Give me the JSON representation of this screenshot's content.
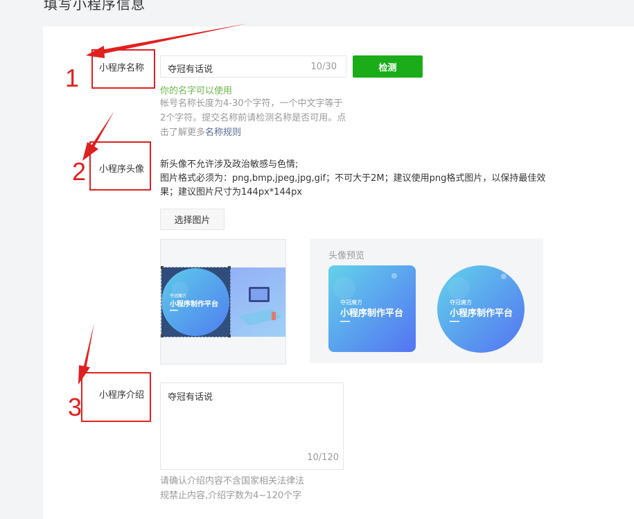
{
  "page": {
    "heading": "填写小程序信息"
  },
  "name_section": {
    "label": "小程序名称",
    "input_value": "夺冠有话说",
    "input_count": "10/30",
    "check_button": "检测",
    "success_text": "你的名字可以使用",
    "hint_line1": "帐号名称长度为4-30个字符，一个中文字等于",
    "hint_line2": "2个字符。提交名称前请检测名称是否可用。点",
    "hint_line3_prefix": "击了解更多",
    "hint_link": "名称规则"
  },
  "avatar_section": {
    "label": "小程序头像",
    "desc_line1": "新头像不允许涉及政治敏感与色情;",
    "desc_line2": "图片格式必须为：png,bmp,jpeg,jpg,gif；不可大于2M；建议使用png格式图片，以保持最佳效",
    "desc_line3": "果；建议图片尺寸为144px*144px",
    "select_button": "选择图片",
    "preview_title": "头像预览",
    "brand_small": "夺冠魔方",
    "brand_big": "小程序制作平台"
  },
  "intro_section": {
    "label": "小程序介绍",
    "textarea_value": "夺冠有话说",
    "textarea_count": "10/120",
    "hint_line1": "请确认介绍内容不含国家相关法律法",
    "hint_line2": "规禁止内容,介绍字数为4~120个字"
  },
  "annotations": [
    "1",
    "2",
    "3"
  ],
  "colors": {
    "accent_green": "#1aad19",
    "success_green": "#6cb64c",
    "annotation_red": "#e02020",
    "link_blue": "#576b95"
  }
}
